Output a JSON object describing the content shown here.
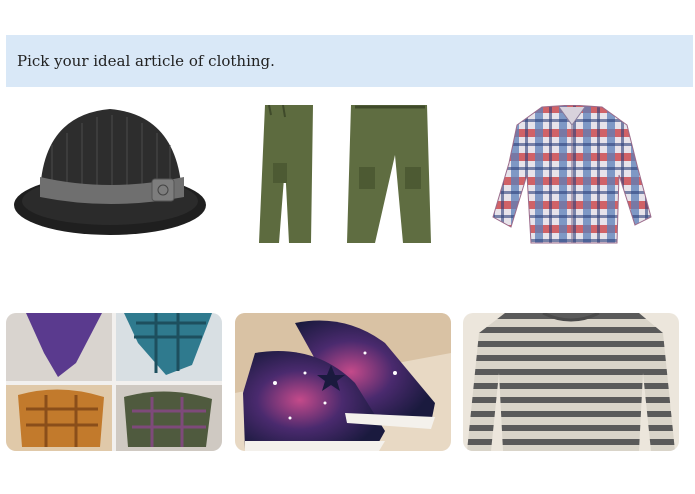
{
  "question": {
    "text": "Pick your ideal article of clothing."
  },
  "options": [
    {
      "name": "hat",
      "icon": "fedora-hat-image"
    },
    {
      "name": "pants",
      "icon": "cargo-pants-image"
    },
    {
      "name": "shirt",
      "icon": "plaid-shirt-image"
    },
    {
      "name": "scarves",
      "icon": "scarves-collage-image"
    },
    {
      "name": "sneakers",
      "icon": "galaxy-sneakers-image"
    },
    {
      "name": "sweater",
      "icon": "striped-sweater-image"
    }
  ],
  "colors": {
    "question_bg": "#d9e8f7",
    "hat": "#2b2b2b",
    "hat_band": "#6f6f6f",
    "pants": "#5d6b3f",
    "shirt_red": "#c8363a",
    "shirt_blue": "#5b7fb8",
    "sneaker_galaxy": "#4a2a6e",
    "sweater_gray": "#8a8a8a"
  }
}
